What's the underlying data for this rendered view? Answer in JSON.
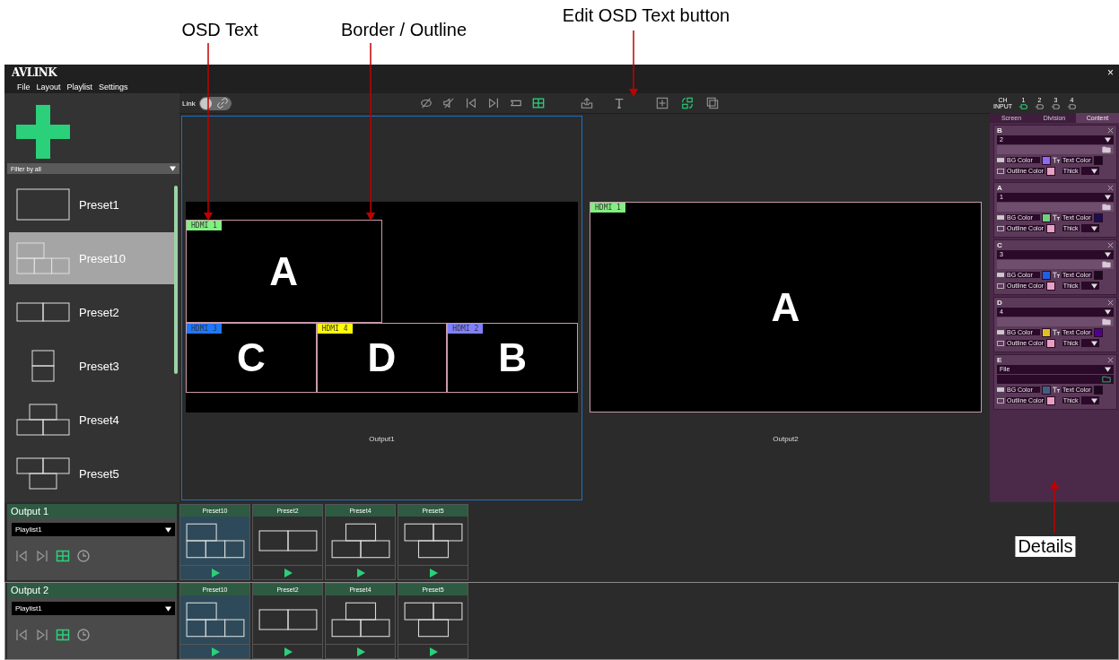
{
  "annotations": [
    {
      "label": "OSD Text",
      "kind": "osd"
    },
    {
      "label": "Border / Outline",
      "kind": "border"
    },
    {
      "label": "Edit OSD Text button",
      "kind": "edit"
    },
    {
      "label": "Details",
      "kind": "details"
    }
  ],
  "app": {
    "logo": "AVLINK",
    "close": "×"
  },
  "menu": [
    "File",
    "Layout",
    "Playlist",
    "Settings"
  ],
  "sidebar": {
    "filter": "Filter by all",
    "presets": [
      {
        "name": "Preset1",
        "kind": "single",
        "selected": false
      },
      {
        "name": "Preset10",
        "kind": "preset10",
        "selected": true
      },
      {
        "name": "Preset2",
        "kind": "split2",
        "selected": false
      },
      {
        "name": "Preset3",
        "kind": "stack2",
        "selected": false
      },
      {
        "name": "Preset4",
        "kind": "pyramid",
        "selected": false
      },
      {
        "name": "Preset5",
        "kind": "inverted",
        "selected": false
      }
    ]
  },
  "toolbar": {
    "link": {
      "label": "Link",
      "on": false
    },
    "groups": [
      [
        {
          "kind": "hide",
          "active": false
        },
        {
          "kind": "mute",
          "active": false
        },
        {
          "kind": "prev",
          "active": false
        },
        {
          "kind": "next",
          "active": false
        },
        {
          "kind": "label",
          "active": false
        },
        {
          "kind": "grid",
          "active": true
        }
      ],
      [
        {
          "kind": "export",
          "active": false
        },
        {
          "kind": "text",
          "active": false
        }
      ],
      [
        {
          "kind": "frame",
          "active": false
        },
        {
          "kind": "swap",
          "active": true
        },
        {
          "kind": "overlap",
          "active": false
        }
      ]
    ]
  },
  "outputs": [
    {
      "label": "Output1",
      "selected": true,
      "kind": "preset10",
      "windows": [
        {
          "letter": "A",
          "osd": "HDMI 1",
          "color": "#80f080"
        },
        {
          "letter": "C",
          "osd": "HDMI 3",
          "color": "#1e78ff"
        },
        {
          "letter": "D",
          "osd": "HDMI 4",
          "color": "#ffff00"
        },
        {
          "letter": "B",
          "osd": "HDMI 2",
          "color": "#8080ff"
        }
      ]
    },
    {
      "label": "Output2",
      "selected": false,
      "kind": "single",
      "windows": [
        {
          "letter": "A",
          "osd": "HDMI 1",
          "color": "#80f080"
        }
      ]
    }
  ],
  "details": {
    "ch_label": "CH",
    "input_label": "INPUT",
    "channels": [
      {
        "number": "1",
        "selected": true
      },
      {
        "number": "2",
        "selected": false
      },
      {
        "number": "3",
        "selected": false
      },
      {
        "number": "4",
        "selected": false
      }
    ],
    "tabs": [
      {
        "label": "Screen",
        "selected": false
      },
      {
        "label": "Division",
        "selected": false
      },
      {
        "label": "Content",
        "selected": true
      }
    ],
    "cards": [
      {
        "name": "B",
        "source": "2",
        "path_enabled": false,
        "swatches": [
          {
            "kind": "bg",
            "label": "BG Color",
            "color": "#8a6cf0"
          },
          {
            "kind": "text",
            "label": "Text Color",
            "color": "#1a0a1a"
          },
          {
            "kind": "outline",
            "label": "Outline Color",
            "color": "#e8a0c0"
          }
        ],
        "thick_label": "Thick"
      },
      {
        "name": "A",
        "source": "1",
        "path_enabled": false,
        "swatches": [
          {
            "kind": "bg",
            "label": "BG Color",
            "color": "#70d080"
          },
          {
            "kind": "text",
            "label": "Text Color",
            "color": "#1a1050"
          },
          {
            "kind": "outline",
            "label": "Outline Color",
            "color": "#e8a0c0"
          }
        ],
        "thick_label": "Thick"
      },
      {
        "name": "C",
        "source": "3",
        "path_enabled": false,
        "swatches": [
          {
            "kind": "bg",
            "label": "BG Color",
            "color": "#2060e0"
          },
          {
            "kind": "text",
            "label": "Text Color",
            "color": "#1a0a1a"
          },
          {
            "kind": "outline",
            "label": "Outline Color",
            "color": "#e8a0c0"
          }
        ],
        "thick_label": "Thick"
      },
      {
        "name": "D",
        "source": "4",
        "path_enabled": false,
        "swatches": [
          {
            "kind": "bg",
            "label": "BG Color",
            "color": "#e0c020"
          },
          {
            "kind": "text",
            "label": "Text Color",
            "color": "#500090"
          },
          {
            "kind": "outline",
            "label": "Outline Color",
            "color": "#e8a0c0"
          }
        ],
        "thick_label": "Thick"
      },
      {
        "name": "E",
        "source": "File",
        "path_enabled": true,
        "swatches": [
          {
            "kind": "bg",
            "label": "BG Color",
            "color": "#406080"
          },
          {
            "kind": "text",
            "label": "Text Color",
            "color": "#1a0a1a"
          },
          {
            "kind": "outline",
            "label": "Outline Color",
            "color": "#e8a0c0"
          }
        ],
        "thick_label": "Thick"
      }
    ]
  },
  "playlists": [
    {
      "output": "Output 1",
      "playlist": "Playlist1",
      "selected": false,
      "controls": [
        {
          "kind": "prev",
          "active": false
        },
        {
          "kind": "next",
          "active": false
        },
        {
          "kind": "grid",
          "active": true
        },
        {
          "kind": "clock",
          "active": false
        }
      ],
      "items": [
        {
          "name": "Preset10",
          "kind": "preset10",
          "selected": true
        },
        {
          "name": "Preset2",
          "kind": "split2",
          "selected": false
        },
        {
          "name": "Preset4",
          "kind": "pyramid",
          "selected": false
        },
        {
          "name": "Preset5",
          "kind": "inverted",
          "selected": false
        }
      ]
    },
    {
      "output": "Output 2",
      "playlist": "Playlist1",
      "selected": true,
      "controls": [
        {
          "kind": "prev",
          "active": false
        },
        {
          "kind": "next",
          "active": false
        },
        {
          "kind": "grid",
          "active": true
        },
        {
          "kind": "clock",
          "active": false
        }
      ],
      "items": [
        {
          "name": "Preset10",
          "kind": "preset10",
          "selected": true
        },
        {
          "name": "Preset2",
          "kind": "split2",
          "selected": false
        },
        {
          "name": "Preset4",
          "kind": "pyramid",
          "selected": false
        },
        {
          "name": "Preset5",
          "kind": "inverted",
          "selected": false
        }
      ]
    }
  ]
}
